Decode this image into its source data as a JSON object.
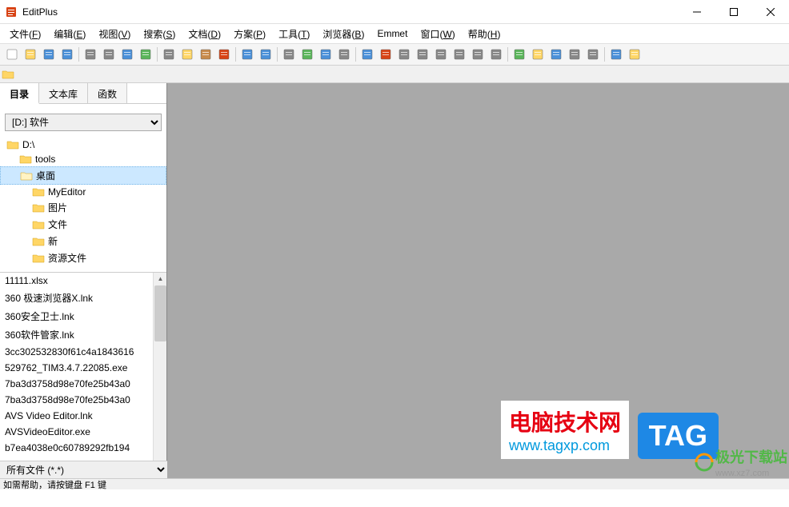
{
  "window": {
    "title": "EditPlus"
  },
  "menu": {
    "items": [
      {
        "label": "文件",
        "key": "F"
      },
      {
        "label": "编辑",
        "key": "E"
      },
      {
        "label": "视图",
        "key": "V"
      },
      {
        "label": "搜索",
        "key": "S"
      },
      {
        "label": "文档",
        "key": "D"
      },
      {
        "label": "方案",
        "key": "P"
      },
      {
        "label": "工具",
        "key": "T"
      },
      {
        "label": "浏览器",
        "key": "B"
      },
      {
        "label": "Emmet",
        "key": ""
      },
      {
        "label": "窗口",
        "key": "W"
      },
      {
        "label": "帮助",
        "key": "H"
      }
    ]
  },
  "toolbar_icons": [
    "new-file",
    "open-file",
    "save",
    "save-all",
    "sep",
    "print",
    "preview",
    "print-preview",
    "hex-view",
    "sep",
    "cut",
    "copy",
    "paste",
    "delete",
    "sep",
    "undo",
    "redo",
    "sep",
    "find",
    "replace",
    "goto",
    "spell",
    "sep",
    "word-wrap",
    "font",
    "hex",
    "bold",
    "invisible",
    "line-num",
    "ruler",
    "settings",
    "sep",
    "browser-view",
    "browser-edit",
    "browser-reload",
    "tile-horz",
    "tile-vert",
    "sep",
    "help-arrow",
    "directory"
  ],
  "sidebar": {
    "tabs": [
      {
        "label": "目录",
        "active": true
      },
      {
        "label": "文本库",
        "active": false
      },
      {
        "label": "函数",
        "active": false
      }
    ],
    "drive_selected": "[D:] 软件",
    "folders": [
      {
        "name": "D:\\",
        "indent": 0,
        "selected": false
      },
      {
        "name": "tools",
        "indent": 1,
        "selected": false
      },
      {
        "name": "桌面",
        "indent": 1,
        "selected": true
      },
      {
        "name": "MyEditor",
        "indent": 2,
        "selected": false
      },
      {
        "name": "图片",
        "indent": 2,
        "selected": false
      },
      {
        "name": "文件",
        "indent": 2,
        "selected": false
      },
      {
        "name": "新",
        "indent": 2,
        "selected": false
      },
      {
        "name": "资源文件",
        "indent": 2,
        "selected": false
      }
    ],
    "files": [
      "11111.xlsx",
      "360 极速浏览器X.lnk",
      "360安全卫士.lnk",
      "360软件管家.lnk",
      "3cc302532830f61c4a1843616",
      "529762_TIM3.4.7.22085.exe",
      "7ba3d3758d98e70fe25b43a0",
      "7ba3d3758d98e70fe25b43a0",
      "AVS Video Editor.lnk",
      "AVSVideoEditor.exe",
      "b7ea4038e0c60789292fb194"
    ],
    "filter": "所有文件 (*.*)"
  },
  "statusbar": {
    "text": "如需帮助，请按键盘 F1 键"
  },
  "watermarks": {
    "w1_text": "电脑技术网",
    "w1_url": "www.tagxp.com",
    "tag": "TAG",
    "w2_text": "极光下载站",
    "w2_url": "www.xz7.com"
  }
}
